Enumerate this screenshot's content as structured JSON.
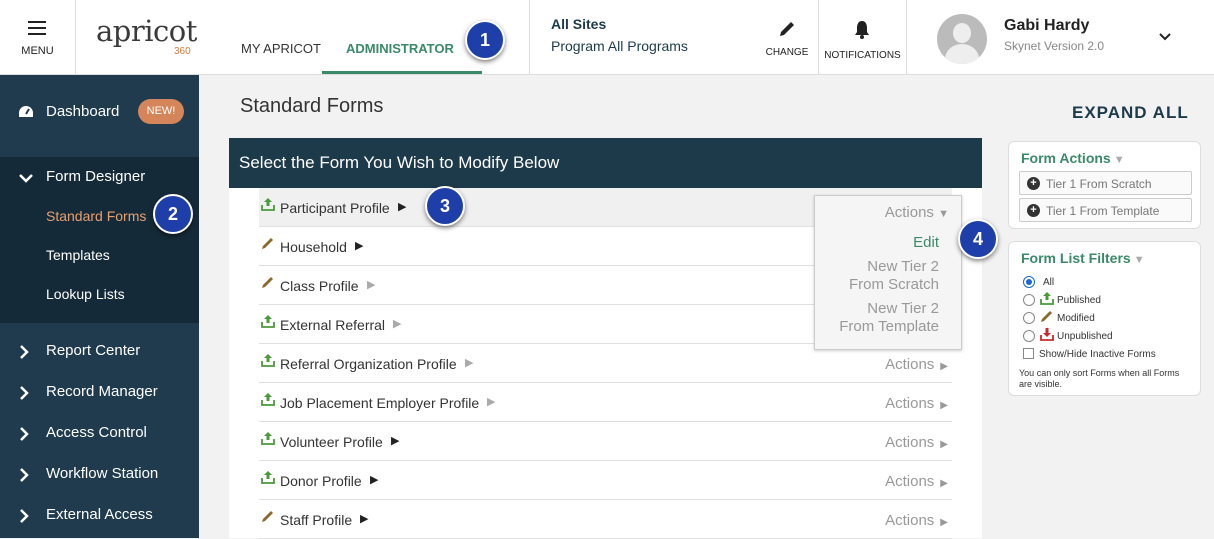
{
  "topbar": {
    "menu_label": "MENU",
    "logo_text": "apricot",
    "logo_sub": "360",
    "tabs": [
      {
        "label": "MY APRICOT",
        "active": false
      },
      {
        "label": "ADMINISTRATOR",
        "active": true
      }
    ],
    "site_title": "All Sites",
    "site_program": "Program All Programs",
    "change_label": "CHANGE",
    "notifications_label": "NOTIFICATIONS",
    "user_name": "Gabi Hardy",
    "user_version": "Skynet Version 2.0"
  },
  "sidebar": {
    "dashboard": "Dashboard",
    "new_badge": "NEW!",
    "form_designer": "Form Designer",
    "form_designer_items": [
      "Standard Forms",
      "Templates",
      "Lookup Lists"
    ],
    "sections": [
      "Report Center",
      "Record Manager",
      "Access Control",
      "Workflow Station",
      "External Access"
    ]
  },
  "main": {
    "title": "Standard Forms",
    "expand_all": "EXPAND ALL",
    "panel_header": "Select the Form You Wish to Modify Below",
    "actions_label": "Actions",
    "forms": [
      {
        "name": "Participant Profile",
        "status": "published",
        "expandable": true
      },
      {
        "name": "Household",
        "status": "modified",
        "expandable": true
      },
      {
        "name": "Class Profile",
        "status": "modified",
        "expandable": false
      },
      {
        "name": "External Referral",
        "status": "published",
        "expandable": false
      },
      {
        "name": "Referral Organization Profile",
        "status": "published",
        "expandable": false
      },
      {
        "name": "Job Placement Employer Profile",
        "status": "published",
        "expandable": false
      },
      {
        "name": "Volunteer Profile",
        "status": "published",
        "expandable": true
      },
      {
        "name": "Donor Profile",
        "status": "published",
        "expandable": true
      },
      {
        "name": "Staff Profile",
        "status": "modified",
        "expandable": true
      }
    ],
    "dropdown": {
      "header": "Actions",
      "edit": "Edit",
      "new_scratch_1": "New Tier 2",
      "new_scratch_2": "From Scratch",
      "new_template_1": "New Tier 2",
      "new_template_2": "From Template"
    }
  },
  "form_actions": {
    "title": "Form Actions",
    "buttons": [
      "Tier 1 From Scratch",
      "Tier 1 From Template"
    ]
  },
  "filters": {
    "title": "Form List Filters",
    "options": [
      "All",
      "Published",
      "Modified",
      "Unpublished"
    ],
    "selected": "All",
    "show_inactive": "Show/Hide Inactive Forms",
    "note": "You can only sort Forms when all Forms are visible."
  },
  "callouts": [
    "1",
    "2",
    "3",
    "4"
  ],
  "colors": {
    "accent_green": "#3a8a6a",
    "sidebar_bg": "#1f3b4d",
    "header_bg": "#1c3a4a",
    "badge_orange": "#d4855a",
    "callout_blue": "#1e3faa"
  }
}
